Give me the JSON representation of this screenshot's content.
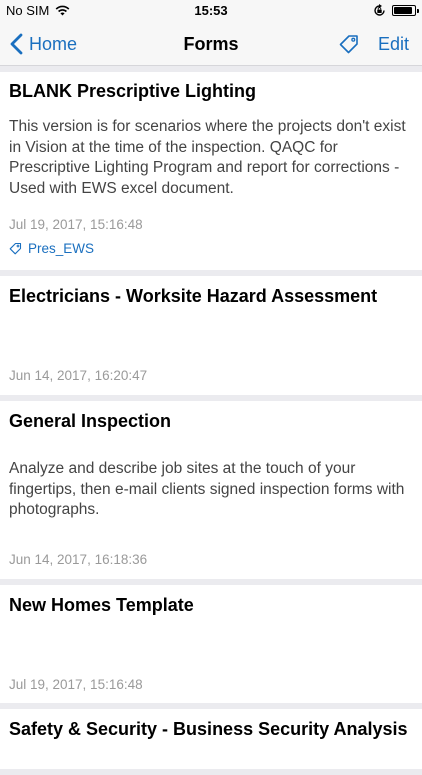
{
  "status": {
    "carrier": "No SIM",
    "time": "15:53",
    "battery_level": 0.92
  },
  "nav": {
    "back_label": "Home",
    "title": "Forms",
    "edit_label": "Edit",
    "tag_icon": "tag-icon"
  },
  "forms": [
    {
      "title": "BLANK Prescriptive Lighting",
      "description": "This version is for scenarios where the projects don't exist in Vision at the time of the inspection. QAQC for Prescriptive Lighting Program and report for corrections - Used with EWS excel document.",
      "date": "Jul 19, 2017, 15:16:48",
      "tag": "Pres_EWS"
    },
    {
      "title": "Electricians - Worksite Hazard Assessment",
      "description": "",
      "date": "Jun 14, 2017, 16:20:47"
    },
    {
      "title": "General Inspection",
      "description": "Analyze and describe job sites at the touch of your fingertips, then e-mail clients signed inspection forms with photographs.",
      "date": "Jun 14, 2017, 16:18:36"
    },
    {
      "title": "New Homes Template",
      "description": "",
      "date": "Jul 19, 2017, 15:16:48"
    },
    {
      "title": "Safety & Security - Business Security Analysis"
    }
  ],
  "colors": {
    "accent": "#1a6fbf",
    "background": "#ebebef",
    "date_text": "#9a9a9a"
  }
}
